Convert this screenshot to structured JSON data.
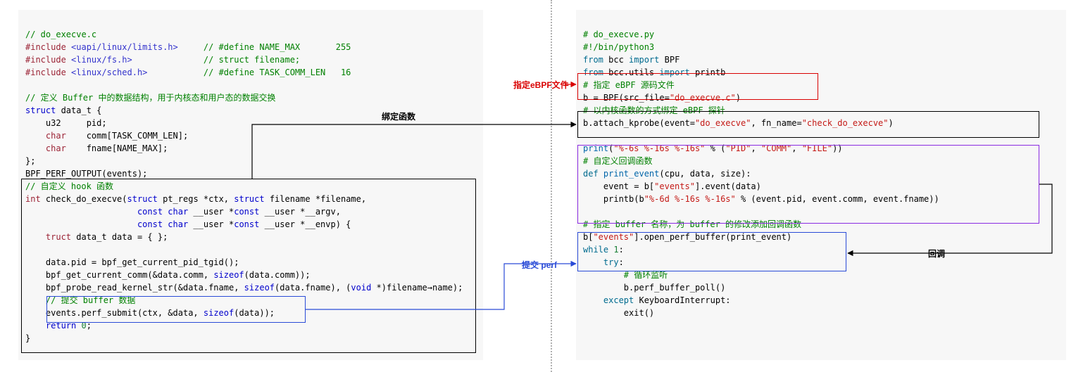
{
  "left": {
    "l01": "// do_execve.c",
    "l02a": "#include",
    "l02b": "<uapi/linux/limits.h>",
    "l02c": "// #define NAME_MAX       255",
    "l03a": "#include",
    "l03b": "<linux/fs.h>",
    "l03c": "// struct filename;",
    "l04a": "#include",
    "l04b": "<linux/sched.h>",
    "l04c": "// #define TASK_COMM_LEN   16",
    "l06": "// 定义 Buffer 中的数据结构，用于内核态和用户态的数据交换",
    "l07a": "struct",
    "l07b": " data_t {",
    "l08a": "    u32     pid;",
    "l09a": "    char",
    "l09b": "    comm[TASK_COMM_LEN];",
    "l10a": "    char",
    "l10b": "    fname[NAME_MAX];",
    "l11": "};",
    "l12": "BPF_PERF_OUTPUT(events);",
    "l13": "// 自定义 hook 函数",
    "l14a": "int",
    "l14b": " check_do_execve(",
    "l14c": "struct",
    "l14d": " pt_regs *ctx, ",
    "l14e": "struct",
    "l14f": " filename *filename,",
    "l15a": "                      ",
    "l15b": "const char",
    "l15c": " __user *",
    "l15d": "const",
    "l15e": " __user *__argv,",
    "l16a": "                      ",
    "l16b": "const char",
    "l16c": " __user *",
    "l16d": "const",
    "l16e": " __user *__envp) {",
    "l17a": "    truct",
    "l17b": " data_t data = { };",
    "l19": "    data.pid = bpf_get_current_pid_tgid();",
    "l20a": "    bpf_get_current_comm(&data.comm, ",
    "l20b": "sizeof",
    "l20c": "(data.comm));",
    "l21a": "    bpf_probe_read_kernel_str(&data.fname, ",
    "l21b": "sizeof",
    "l21c": "(data.fname), (",
    "l21d": "void",
    "l21e": " *)filename→name);",
    "l22": "    // 提交 buffer 数据",
    "l23a": "    events.perf_submit(ctx, &data, ",
    "l23b": "sizeof",
    "l23c": "(data));",
    "l24a": "    return",
    "l24b": " 0",
    "l24c": ";",
    "l25": "}"
  },
  "right": {
    "r01": "# do_execve.py",
    "r02": "#!/bin/python3",
    "r03a": "from",
    "r03b": " bcc ",
    "r03c": "import",
    "r03d": " BPF",
    "r04a": "from",
    "r04b": " bcc.utils ",
    "r04c": "import",
    "r04d": " printb",
    "r05": "# 指定 eBPF 源码文件",
    "r06a": "b = BPF(src_file=",
    "r06b": "\"do_execve.c\"",
    "r06c": ")",
    "r07": "# 以内核函数的方式绑定 eBPF 探针",
    "r08a": "b.attach_kprobe(event=",
    "r08b": "\"do_execve\"",
    "r08c": ", fn_name=",
    "r08d": "\"check_do_execve\"",
    "r08e": ")",
    "r10a": "print",
    "r10b": "(",
    "r10c": "\"%-6s %-16s %-16s\"",
    "r10d": " % (",
    "r10e": "\"PID\"",
    "r10f": ", ",
    "r10g": "\"COMM\"",
    "r10h": ", ",
    "r10i": "\"FILE\"",
    "r10j": "))",
    "r11": "# 自定义回调函数",
    "r12a": "def",
    "r12b": " print_event",
    "r12c": "(cpu, data, size):",
    "r13a": "    event = b[",
    "r13b": "\"events\"",
    "r13c": "].event(data)",
    "r14a": "    printb(b",
    "r14b": "\"%-6d %-16s %-16s\"",
    "r14c": " % (event.pid, event.comm, event.fname))",
    "r16": "# 指定 buffer 名称，为 buffer 的修改添加回调函数",
    "r17a": "b[",
    "r17b": "\"events\"",
    "r17c": "].open_perf_buffer(print_event)",
    "r18a": "while",
    "r18b": " 1",
    "r18c": ":",
    "r19a": "    try",
    "r19b": ":",
    "r20": "        # 循环监听",
    "r21": "        b.perf_buffer_poll()",
    "r22a": "    except",
    "r22b": " KeyboardInterrupt:",
    "r23": "        exit()"
  },
  "ann": {
    "specify_file": "指定eBPF文件",
    "bind_fn": "绑定函数",
    "submit_perf": "提交 perf",
    "callback": "回调"
  },
  "colors": {
    "red": "#d90000",
    "blue": "#2a4bd7",
    "black": "#000000",
    "purple": "#8a2be2"
  }
}
